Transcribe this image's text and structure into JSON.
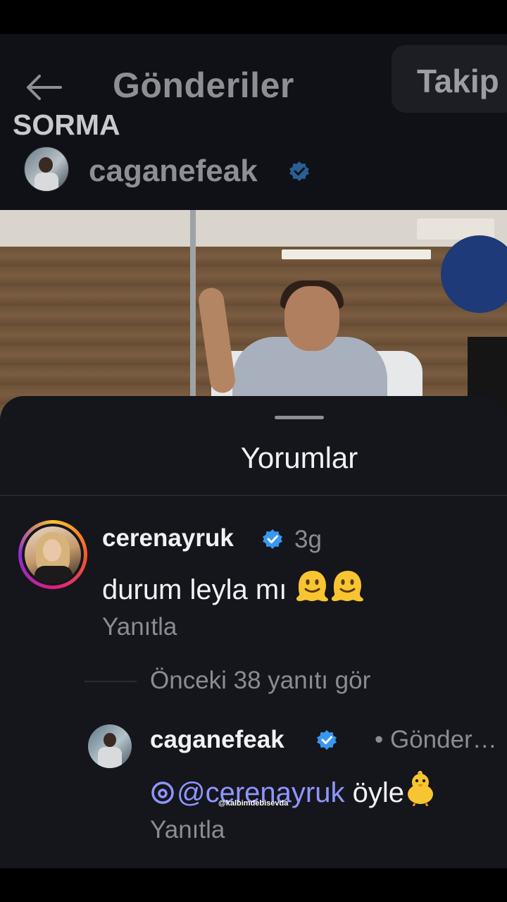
{
  "header": {
    "back_icon": "arrow-left-icon",
    "title": "Gönderiler",
    "follow_label": "Takip",
    "overlay_caption": "SORMA",
    "author": "caganefeak"
  },
  "comments_sheet": {
    "title": "Yorumlar",
    "comments": [
      {
        "username": "cerenayruk",
        "verified": true,
        "time": "3g",
        "text": "durum leyla mı",
        "emoji": "melting-face-icon ×2",
        "reply_label": "Yanıtla",
        "view_replies": "Önceki 38 yanıtı gör"
      },
      {
        "username": "caganefeak",
        "verified": true,
        "sent_label": "• Gönder…",
        "mention": "@cerenayruk",
        "text": "öyle",
        "emoji": "baby-chick-icon",
        "reply_label": "Yanıtla"
      }
    ]
  },
  "watermark": "@kalbimdebisevda",
  "colors": {
    "background": "#15161b",
    "header_bg": "#101116",
    "verified_blue": "#3897f0",
    "mention_purple": "#8f95ff",
    "secondary_text": "#8b8c90"
  }
}
